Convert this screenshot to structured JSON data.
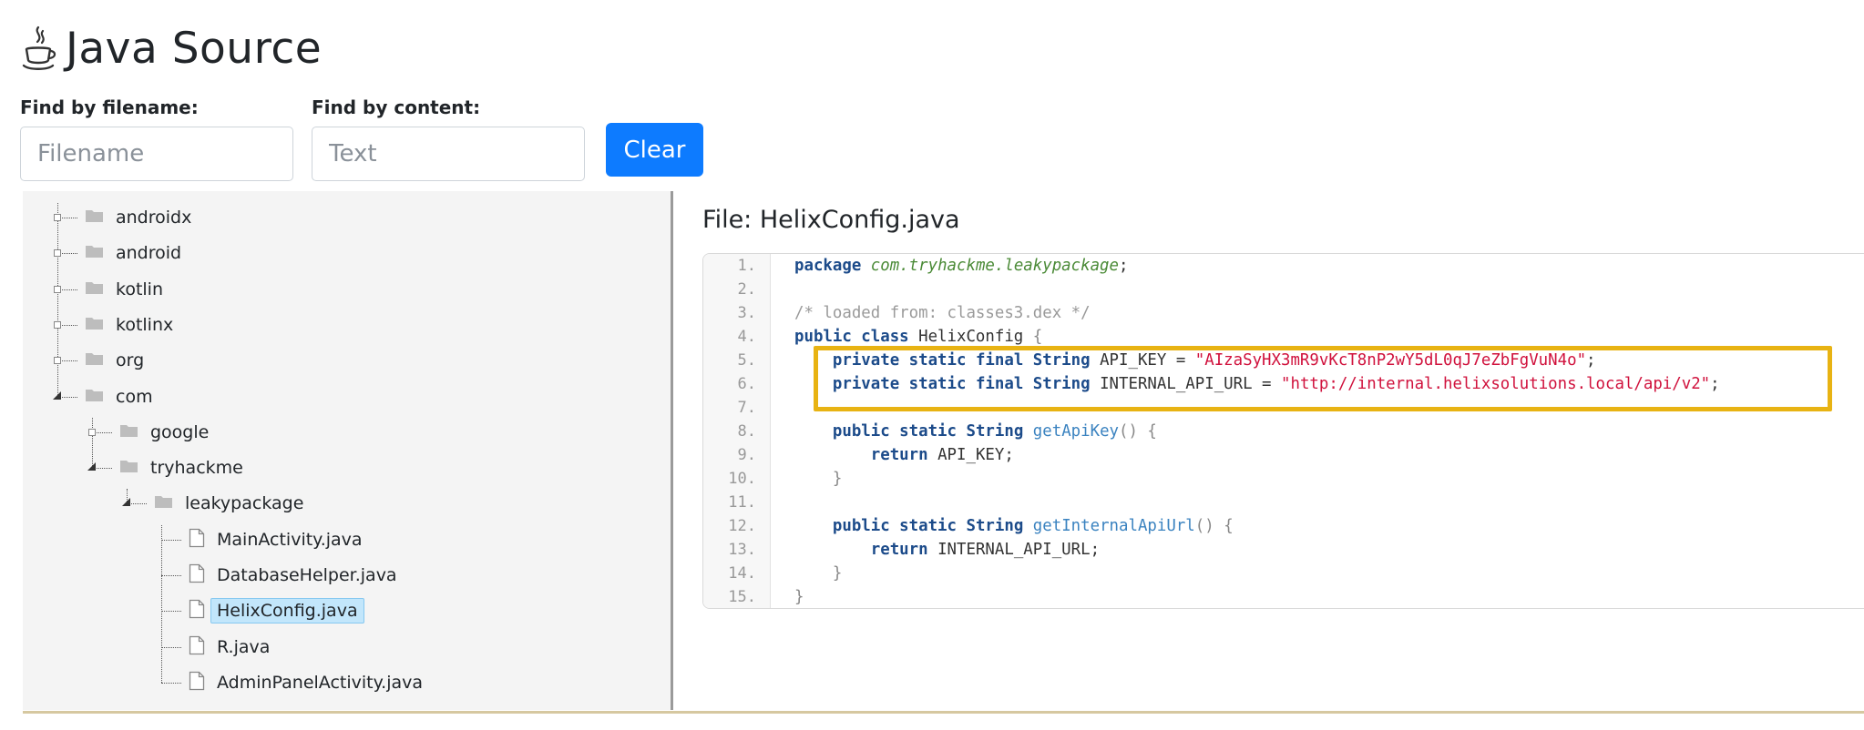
{
  "header": {
    "title": "Java Source",
    "icon": "java-cup-icon"
  },
  "search": {
    "filename_label": "Find by filename:",
    "filename_placeholder": "Filename",
    "filename_value": "",
    "content_label": "Find by content:",
    "content_placeholder": "Text",
    "content_value": "",
    "clear_label": "Clear"
  },
  "tree": {
    "nodes": [
      {
        "label": "androidx",
        "type": "folder",
        "depth": 0,
        "state": "collapsed"
      },
      {
        "label": "android",
        "type": "folder",
        "depth": 0,
        "state": "collapsed"
      },
      {
        "label": "kotlin",
        "type": "folder",
        "depth": 0,
        "state": "collapsed"
      },
      {
        "label": "kotlinx",
        "type": "folder",
        "depth": 0,
        "state": "collapsed"
      },
      {
        "label": "org",
        "type": "folder",
        "depth": 0,
        "state": "collapsed"
      },
      {
        "label": "com",
        "type": "folder",
        "depth": 0,
        "state": "expanded"
      },
      {
        "label": "google",
        "type": "folder",
        "depth": 1,
        "state": "collapsed"
      },
      {
        "label": "tryhackme",
        "type": "folder",
        "depth": 1,
        "state": "expanded"
      },
      {
        "label": "leakypackage",
        "type": "folder",
        "depth": 2,
        "state": "expanded"
      },
      {
        "label": "MainActivity.java",
        "type": "file",
        "depth": 3
      },
      {
        "label": "DatabaseHelper.java",
        "type": "file",
        "depth": 3
      },
      {
        "label": "HelixConfig.java",
        "type": "file",
        "depth": 3,
        "selected": true
      },
      {
        "label": "R.java",
        "type": "file",
        "depth": 3
      },
      {
        "label": "AdminPanelActivity.java",
        "type": "file",
        "depth": 3
      }
    ]
  },
  "file": {
    "title": "File: HelixConfig.java",
    "lines": [
      {
        "n": "1.",
        "segs": [
          [
            "kw",
            "package"
          ],
          [
            "t",
            " "
          ],
          [
            "pkg",
            "com.tryhackme.leakypackage"
          ],
          [
            "t",
            ";"
          ]
        ]
      },
      {
        "n": "2.",
        "segs": []
      },
      {
        "n": "3.",
        "segs": [
          [
            "cmt",
            "/* loaded from: classes3.dex */"
          ]
        ]
      },
      {
        "n": "4.",
        "segs": [
          [
            "kw",
            "public class"
          ],
          [
            "t",
            " HelixConfig "
          ],
          [
            "brace",
            "{"
          ]
        ]
      },
      {
        "n": "5.",
        "segs": [
          [
            "t",
            "    "
          ],
          [
            "kw",
            "private static final String"
          ],
          [
            "t",
            " API_KEY = "
          ],
          [
            "str",
            "\"AIzaSyHX3mR9vKcT8nP2wY5dL0qJ7eZbFgVuN4o\""
          ],
          [
            "t",
            ";"
          ]
        ]
      },
      {
        "n": "6.",
        "segs": [
          [
            "t",
            "    "
          ],
          [
            "kw",
            "private static final String"
          ],
          [
            "t",
            " INTERNAL_API_URL = "
          ],
          [
            "str",
            "\"http://internal.helixsolutions.local/api/v2\""
          ],
          [
            "t",
            ";"
          ]
        ]
      },
      {
        "n": "7.",
        "segs": []
      },
      {
        "n": "8.",
        "segs": [
          [
            "t",
            "    "
          ],
          [
            "kw",
            "public static String"
          ],
          [
            "t",
            " "
          ],
          [
            "fn",
            "getApiKey"
          ],
          [
            "brace",
            "() {"
          ]
        ]
      },
      {
        "n": "9.",
        "segs": [
          [
            "t",
            "        "
          ],
          [
            "kw",
            "return"
          ],
          [
            "t",
            " API_KEY;"
          ]
        ]
      },
      {
        "n": "10.",
        "segs": [
          [
            "t",
            "    "
          ],
          [
            "brace",
            "}"
          ]
        ]
      },
      {
        "n": "11.",
        "segs": []
      },
      {
        "n": "12.",
        "segs": [
          [
            "t",
            "    "
          ],
          [
            "kw",
            "public static String"
          ],
          [
            "t",
            " "
          ],
          [
            "fn",
            "getInternalApiUrl"
          ],
          [
            "brace",
            "() {"
          ]
        ]
      },
      {
        "n": "13.",
        "segs": [
          [
            "t",
            "        "
          ],
          [
            "kw",
            "return"
          ],
          [
            "t",
            " INTERNAL_API_URL;"
          ]
        ]
      },
      {
        "n": "14.",
        "segs": [
          [
            "t",
            "    "
          ],
          [
            "brace",
            "}"
          ]
        ]
      },
      {
        "n": "15.",
        "segs": [
          [
            "brace",
            "}"
          ]
        ]
      }
    ]
  },
  "colors": {
    "accent": "#0d7bff",
    "highlight": "#e8b313",
    "selected": "#c2e6fb"
  }
}
